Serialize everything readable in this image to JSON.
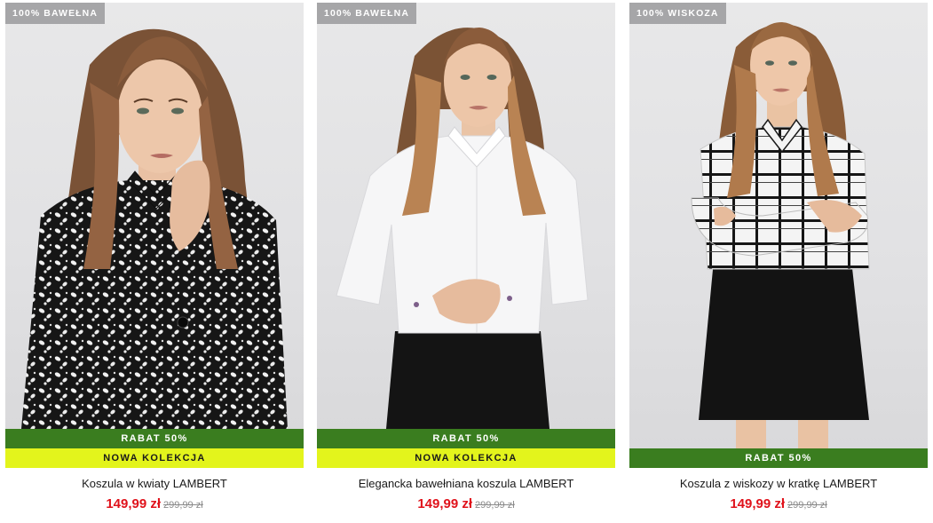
{
  "products": [
    {
      "tag": "100% BAWEŁNA",
      "name": "Koszula w kwiaty LAMBERT",
      "price": "149,99 zł",
      "old_price": "299,99 zł",
      "badges": [
        "RABAT 50%",
        "NOWA KOLEKCJA"
      ]
    },
    {
      "tag": "100% BAWEŁNA",
      "name": "Elegancka bawełniana koszula LAMBERT",
      "price": "149,99 zł",
      "old_price": "299,99 zł",
      "badges": [
        "RABAT 50%",
        "NOWA KOLEKCJA"
      ]
    },
    {
      "tag": "100% WISKOZA",
      "name": "Koszula z wiskozy w kratkę LAMBERT",
      "price": "149,99 zł",
      "old_price": "299,99 zł",
      "badges": [
        "RABAT 50%"
      ]
    }
  ],
  "colors": {
    "discount_badge": "#3a7d1f",
    "new_collection_badge": "#e3f41c",
    "material_tag": "#a6a6a8",
    "price": "#e0121b"
  }
}
